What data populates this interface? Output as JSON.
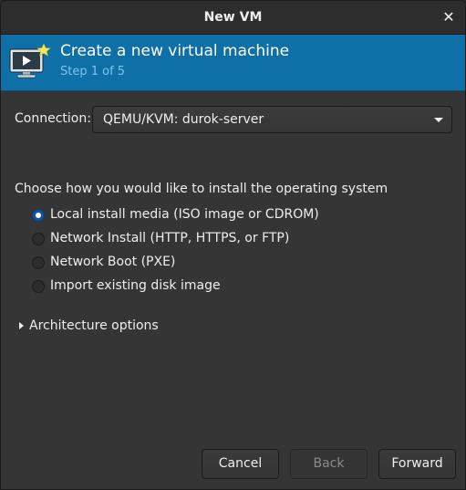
{
  "window": {
    "title": "New VM",
    "close_icon": "close-icon"
  },
  "banner": {
    "icon": "virtual-machine-new-icon",
    "title": "Create a new virtual machine",
    "subtitle": "Step 1 of 5",
    "background_color": "#0f6fa7",
    "subtitle_color": "#7fc3ef"
  },
  "connection": {
    "label": "Connection:",
    "selected": "QEMU/KVM: durok-server"
  },
  "install": {
    "prompt": "Choose how you would like to install the operating system",
    "options": [
      {
        "label": "Local install media (ISO image or CDROM)",
        "checked": true
      },
      {
        "label": "Network Install (HTTP, HTTPS, or FTP)",
        "checked": false
      },
      {
        "label": "Network Boot (PXE)",
        "checked": false
      },
      {
        "label": "Import existing disk image",
        "checked": false
      }
    ]
  },
  "architecture": {
    "label": "Architecture options",
    "expanded": false
  },
  "buttons": {
    "cancel": "Cancel",
    "back": "Back",
    "back_enabled": false,
    "forward": "Forward"
  }
}
